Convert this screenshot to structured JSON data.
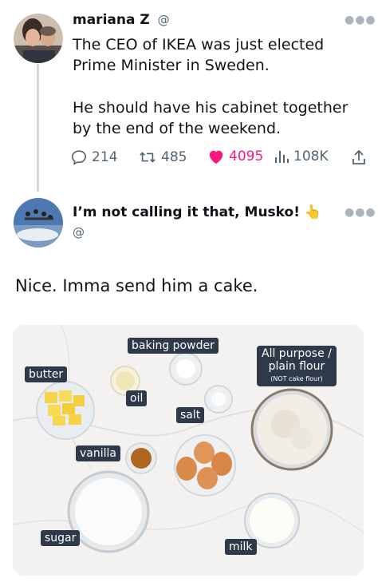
{
  "tweet": {
    "author_name": "mariana Z",
    "author_handle": "@",
    "text_line1": "The CEO of IKEA was just elected",
    "text_line2": "Prime Minister in Sweden.",
    "text_line3": "He should have his cabinet together",
    "text_line4": "by the end of the weekend.",
    "replies": "214",
    "retweets": "485",
    "likes": "4095",
    "views": "108K",
    "more_icon": "more-dots-icon"
  },
  "reply": {
    "author_name": "I’m not calling it that, Musko!",
    "author_emoji": "👆",
    "author_handle": "@",
    "text": "Nice. Imma send him a cake."
  },
  "image_labels": {
    "baking_powder": "baking powder",
    "butter": "butter",
    "oil": "oil",
    "salt": "salt",
    "flour_main_1": "All purpose /",
    "flour_main_2": "plain flour",
    "flour_sub": "(NOT cake flour)",
    "vanilla": "vanilla",
    "sugar": "sugar",
    "milk": "milk"
  },
  "colors": {
    "like_pink": "#f91880",
    "icon_gray": "#536471",
    "label_bg": "#2e3a4a"
  }
}
